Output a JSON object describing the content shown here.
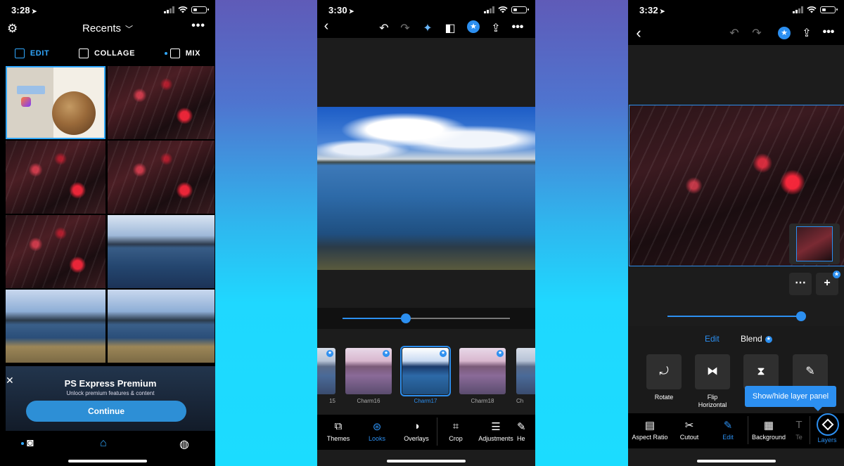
{
  "colors": {
    "accent": "#2c8ff0",
    "accent_light": "#31a8ff",
    "panel": "#1c1c1c",
    "background_top": "#5f5bb8",
    "background_bottom": "#1bdcff"
  },
  "phone1": {
    "status_time": "3:28",
    "header": {
      "title": "Recents",
      "settings_icon": "gear-icon",
      "more_icon": "more-icon"
    },
    "modes": [
      {
        "label": "EDIT",
        "active": true
      },
      {
        "label": "COLLAGE",
        "active": false
      },
      {
        "label": "MIX",
        "active": false
      }
    ],
    "premium": {
      "title": "PS Express Premium",
      "subtitle": "Unlock premium features & content",
      "button": "Continue"
    },
    "tabbar": [
      "camera-icon",
      "home-icon",
      "globe-icon"
    ]
  },
  "phone2": {
    "status_time": "3:30",
    "toolbar_icons": [
      "back-icon",
      "undo-icon",
      "redo-icon",
      "magic-wand-icon",
      "compare-icon",
      "premium-star-icon",
      "share-icon",
      "more-icon"
    ],
    "slider": {
      "value": 0.38
    },
    "looks": [
      {
        "label": "15",
        "variant": "b",
        "premium": true,
        "selected": false
      },
      {
        "label": "Charm16",
        "variant": "p",
        "premium": true,
        "selected": false
      },
      {
        "label": "Charm17",
        "variant": "g",
        "premium": true,
        "selected": true
      },
      {
        "label": "Charm18",
        "variant": "p",
        "premium": true,
        "selected": false
      },
      {
        "label": "Ch",
        "variant": "b",
        "premium": true,
        "selected": false
      }
    ],
    "bottom_tabs": [
      {
        "label": "Themes",
        "icon": "themes-icon",
        "active": false
      },
      {
        "label": "Looks",
        "icon": "looks-icon",
        "active": true
      },
      {
        "label": "Overlays",
        "icon": "overlays-icon",
        "active": false
      },
      {
        "label": "Crop",
        "icon": "crop-icon",
        "active": false
      },
      {
        "label": "Adjustments",
        "icon": "adjustments-icon",
        "active": false
      },
      {
        "label": "He",
        "icon": "heal-icon",
        "active": false
      }
    ]
  },
  "phone3": {
    "status_time": "3:32",
    "slider": {
      "value": 1.0
    },
    "segments": [
      {
        "label": "Edit",
        "active": true,
        "premium": false
      },
      {
        "label": "Blend",
        "active": false,
        "premium": true
      }
    ],
    "tools": [
      {
        "label": "Rotate",
        "icon": "rotate-icon"
      },
      {
        "label": "Flip Horizontal",
        "icon": "flip-horizontal-icon"
      },
      {
        "label": "",
        "icon": "flip-vertical-icon"
      },
      {
        "label": "",
        "icon": "edit-pencil-icon"
      }
    ],
    "tooltip": "Show/hide layer panel",
    "bottom_tabs": [
      {
        "label": "Aspect Ratio",
        "icon": "aspect-ratio-icon",
        "active": false
      },
      {
        "label": "Cutout",
        "icon": "cutout-icon",
        "active": false
      },
      {
        "label": "Edit",
        "icon": "edit-icon",
        "active": true
      },
      {
        "label": "Background",
        "icon": "background-icon",
        "active": false
      },
      {
        "label": "Te",
        "icon": "text-icon",
        "active": false
      },
      {
        "label": "Layers",
        "icon": "layers-icon",
        "active": true
      }
    ]
  }
}
